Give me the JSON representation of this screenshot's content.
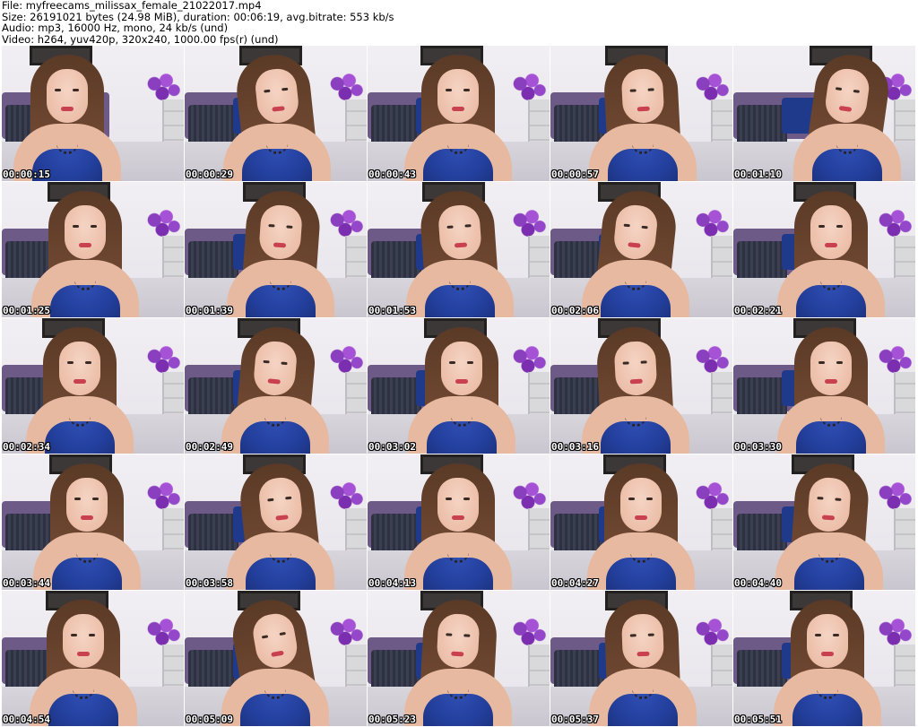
{
  "header": {
    "file_line": "File: myfreecams_milissax_female_21022017.mp4",
    "size_line": "Size: 26191021 bytes (24.98 MiB), duration: 00:06:19, avg.bitrate: 553 kb/s",
    "audio_line": "Audio: mp3, 16000 Hz, mono, 24 kb/s (und)",
    "video_line": "Video: h264, yuv420p, 320x240, 1000.00 fps(r) (und)"
  },
  "thumbnails": [
    {
      "timestamp": "00:00:15"
    },
    {
      "timestamp": "00:00:29"
    },
    {
      "timestamp": "00:00:43"
    },
    {
      "timestamp": "00:00:57"
    },
    {
      "timestamp": "00:01:10"
    },
    {
      "timestamp": "00:01:25"
    },
    {
      "timestamp": "00:01:39"
    },
    {
      "timestamp": "00:01:53"
    },
    {
      "timestamp": "00:02:06"
    },
    {
      "timestamp": "00:02:21"
    },
    {
      "timestamp": "00:02:34"
    },
    {
      "timestamp": "00:02:49"
    },
    {
      "timestamp": "00:03:02"
    },
    {
      "timestamp": "00:03:16"
    },
    {
      "timestamp": "00:03:30"
    },
    {
      "timestamp": "00:03:44"
    },
    {
      "timestamp": "00:03:58"
    },
    {
      "timestamp": "00:04:13"
    },
    {
      "timestamp": "00:04:27"
    },
    {
      "timestamp": "00:04:40"
    },
    {
      "timestamp": "00:04:54"
    },
    {
      "timestamp": "00:05:09"
    },
    {
      "timestamp": "00:05:23"
    },
    {
      "timestamp": "00:05:37"
    },
    {
      "timestamp": "00:05:51"
    }
  ]
}
